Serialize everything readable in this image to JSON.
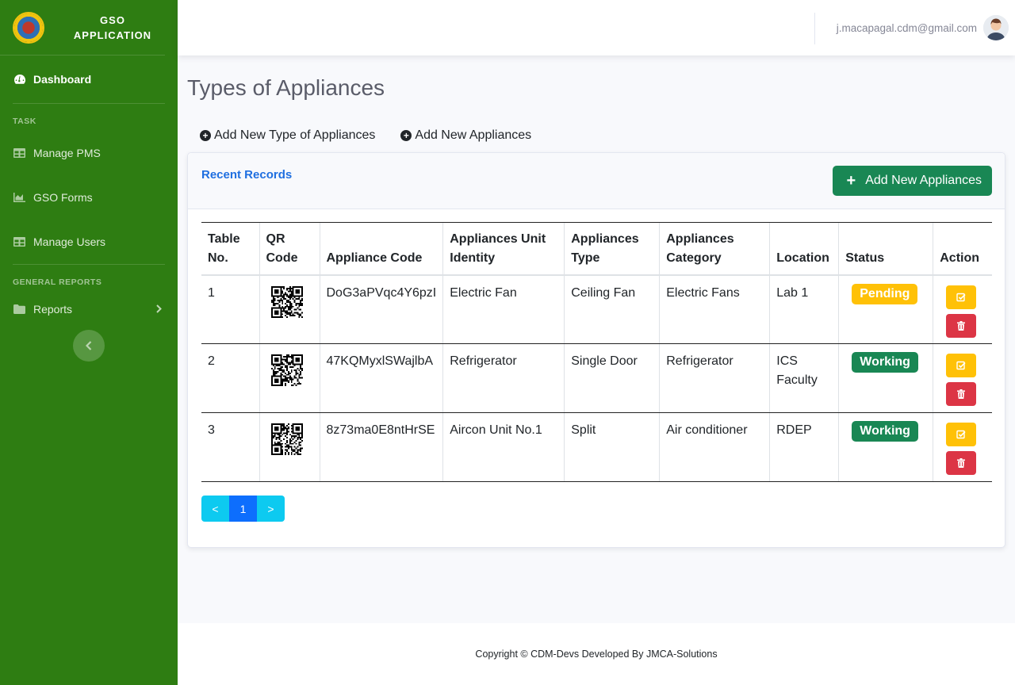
{
  "brand": {
    "line1": "GSO",
    "line2": "APPLICATION"
  },
  "sidebar": {
    "dashboard": "Dashboard",
    "heading_task": "TASK",
    "manage_pms": "Manage PMS",
    "gso_forms": "GSO Forms",
    "manage_users": "Manage Users",
    "heading_reports": "GENERAL REPORTS",
    "reports": "Reports"
  },
  "topbar": {
    "email": "j.macapagal.cdm@gmail.com"
  },
  "page": {
    "title": "Types of Appliances",
    "link_add_type": "Add New Type of Appliances",
    "link_add_appliances": "Add New Appliances"
  },
  "card": {
    "title": "Recent Records",
    "add_button": "Add New Appliances"
  },
  "table": {
    "headers": [
      "Table No.",
      "QR Code",
      "Appliance Code",
      "Appliances Unit Identity",
      "Appliances Type",
      "Appliances Category",
      "Location",
      "Status",
      "Action"
    ],
    "rows": [
      {
        "no": "1",
        "code": "DoG3aPVqc4Y6pzI",
        "identity": "Electric Fan",
        "type": "Ceiling Fan",
        "category": "Electric Fans",
        "location": "Lab 1",
        "status": "Pending",
        "status_color": "#ffc107"
      },
      {
        "no": "2",
        "code": "47KQMyxlSWajlbA",
        "identity": "Refrigerator",
        "type": "Single Door",
        "category": "Refrigerator",
        "location": "ICS Faculty",
        "status": "Working",
        "status_color": "#198754"
      },
      {
        "no": "3",
        "code": "8z73ma0E8ntHrSE",
        "identity": "Aircon Unit No.1",
        "type": "Split",
        "category": "Air conditioner",
        "location": "RDEP",
        "status": "Working",
        "status_color": "#198754"
      }
    ]
  },
  "pagination": {
    "prev": "<",
    "current": "1",
    "next": ">"
  },
  "footer": {
    "text": "Copyright © CDM-Devs Developed By JMCA-Solutions"
  },
  "colors": {
    "sidebar": "#2e7d12",
    "primary_link": "#1f6fe0",
    "success": "#198754",
    "warning": "#ffc107",
    "danger": "#dc3545",
    "info": "#0dcaf0"
  }
}
